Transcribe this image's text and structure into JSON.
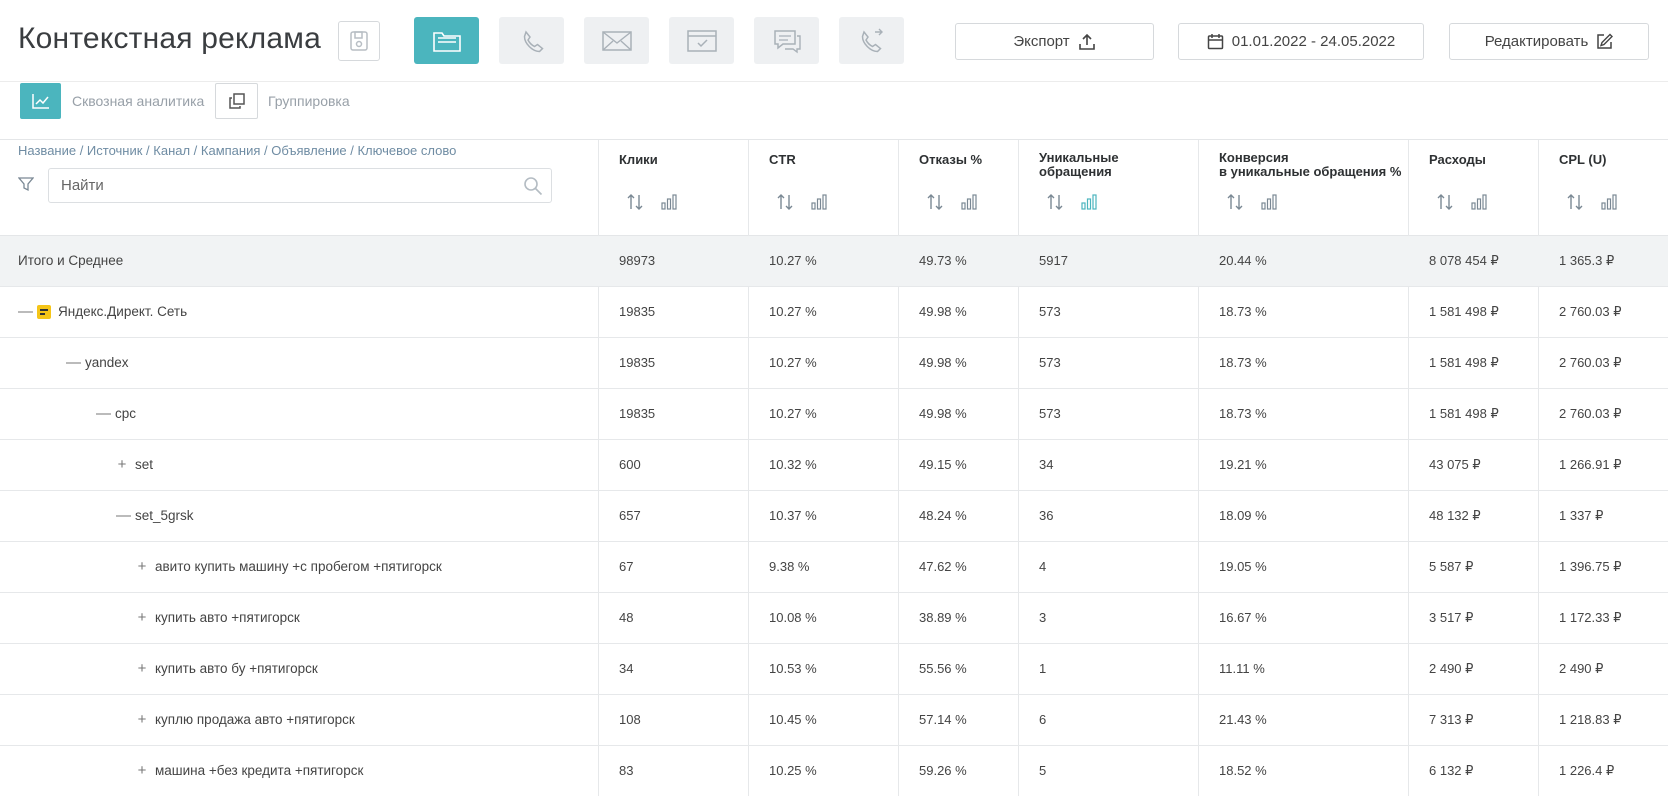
{
  "header": {
    "title": "Контекстная реклама",
    "mode_buttons": [
      {
        "icon": "folder-icon",
        "active": true
      },
      {
        "icon": "phone-icon",
        "active": false
      },
      {
        "icon": "mail-icon",
        "active": false
      },
      {
        "icon": "browser-form-icon",
        "active": false
      },
      {
        "icon": "chat-icon",
        "active": false
      },
      {
        "icon": "callback-icon",
        "active": false
      }
    ],
    "export_label": "Экспорт",
    "date_range": "01.01.2022 - 24.05.2022",
    "edit_label": "Редактировать"
  },
  "subbar": {
    "analytics_label": "Сквозная аналитика",
    "grouping_label": "Группировка"
  },
  "table": {
    "breadcrumb": "Название / Источник / Канал / Кампания / Объявление / Ключевое слово",
    "search_placeholder": "Найти",
    "columns": [
      {
        "line1": "Клики",
        "line2": ""
      },
      {
        "line1": "CTR",
        "line2": ""
      },
      {
        "line1": "Отказы %",
        "line2": ""
      },
      {
        "line1": "Уникальные",
        "line2": "обращения"
      },
      {
        "line1": "Конверсия",
        "line2": "в уникальные обращения %"
      },
      {
        "line1": "Расходы",
        "line2": ""
      },
      {
        "line1": "CPL (U)",
        "line2": ""
      }
    ],
    "rows": [
      {
        "name": "Итого и Среднее",
        "toggle": "",
        "level": 0,
        "total": true,
        "values": [
          "98973",
          "10.27 %",
          "49.73 %",
          "5917",
          "20.44 %",
          "8 078 454 ₽",
          "1 365.3 ₽"
        ]
      },
      {
        "name": "Яндекс.Директ. Сеть",
        "toggle": "—",
        "level": 0,
        "source_icon": true,
        "values": [
          "19835",
          "10.27 %",
          "49.98 %",
          "573",
          "18.73 %",
          "1 581 498 ₽",
          "2 760.03 ₽"
        ]
      },
      {
        "name": "yandex",
        "toggle": "—",
        "level": 1,
        "values": [
          "19835",
          "10.27 %",
          "49.98 %",
          "573",
          "18.73 %",
          "1 581 498 ₽",
          "2 760.03 ₽"
        ]
      },
      {
        "name": "cpc",
        "toggle": "—",
        "level": 2,
        "values": [
          "19835",
          "10.27 %",
          "49.98 %",
          "573",
          "18.73 %",
          "1 581 498 ₽",
          "2 760.03 ₽"
        ]
      },
      {
        "name": "set",
        "toggle": "+",
        "level": 3,
        "values": [
          "600",
          "10.32 %",
          "49.15 %",
          "34",
          "19.21 %",
          "43 075 ₽",
          "1 266.91 ₽"
        ]
      },
      {
        "name": "set_5grsk",
        "toggle": "—",
        "level": 3,
        "values": [
          "657",
          "10.37 %",
          "48.24 %",
          "36",
          "18.09 %",
          "48 132 ₽",
          "1 337 ₽"
        ]
      },
      {
        "name": "авито купить машину +с пробегом +пятигорск",
        "toggle": "+",
        "level": 4,
        "values": [
          "67",
          "9.38 %",
          "47.62 %",
          "4",
          "19.05 %",
          "5 587 ₽",
          "1 396.75 ₽"
        ]
      },
      {
        "name": "купить авто +пятигорск",
        "toggle": "+",
        "level": 4,
        "values": [
          "48",
          "10.08 %",
          "38.89 %",
          "3",
          "16.67 %",
          "3 517 ₽",
          "1 172.33 ₽"
        ]
      },
      {
        "name": "купить авто бу +пятигорск",
        "toggle": "+",
        "level": 4,
        "values": [
          "34",
          "10.53 %",
          "55.56 %",
          "1",
          "11.11 %",
          "2 490 ₽",
          "2 490 ₽"
        ]
      },
      {
        "name": "куплю продажа авто +пятигорск",
        "toggle": "+",
        "level": 4,
        "values": [
          "108",
          "10.45 %",
          "57.14 %",
          "6",
          "21.43 %",
          "7 313 ₽",
          "1 218.83 ₽"
        ]
      },
      {
        "name": "машина +без кредита +пятигорск",
        "toggle": "+",
        "level": 4,
        "values": [
          "83",
          "10.25 %",
          "59.26 %",
          "5",
          "18.52 %",
          "6 132 ₽",
          "1 226.4 ₽"
        ]
      }
    ]
  },
  "colors": {
    "accent": "#4bb5be",
    "muted_button": "#eef0f2",
    "source_icon": "#f5c518"
  }
}
